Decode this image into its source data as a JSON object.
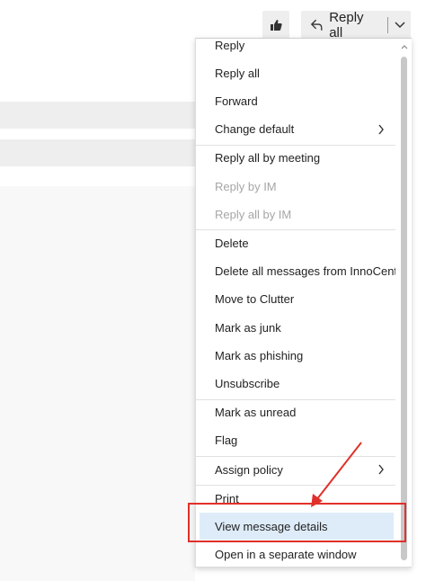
{
  "toolbar": {
    "like_icon": "thumbs-up-icon",
    "reply_all_label": "Reply all",
    "reply_all_icon": "reply-all-icon",
    "more_icon": "chevron-down-icon"
  },
  "menu": {
    "groups": [
      [
        {
          "label": "Reply",
          "enabled": true
        },
        {
          "label": "Reply all",
          "enabled": true
        },
        {
          "label": "Forward",
          "enabled": true
        },
        {
          "label": "Change default",
          "enabled": true,
          "submenu": true
        }
      ],
      [
        {
          "label": "Reply all by meeting",
          "enabled": true
        },
        {
          "label": "Reply by IM",
          "enabled": false
        },
        {
          "label": "Reply all by IM",
          "enabled": false
        }
      ],
      [
        {
          "label": "Delete",
          "enabled": true
        },
        {
          "label": "Delete all messages from InnoCentiv",
          "enabled": true
        },
        {
          "label": "Move to Clutter",
          "enabled": true
        },
        {
          "label": "Mark as junk",
          "enabled": true
        },
        {
          "label": "Mark as phishing",
          "enabled": true
        },
        {
          "label": "Unsubscribe",
          "enabled": true
        }
      ],
      [
        {
          "label": "Mark as unread",
          "enabled": true
        },
        {
          "label": "Flag",
          "enabled": true
        }
      ],
      [
        {
          "label": "Assign policy",
          "enabled": true,
          "submenu": true
        }
      ],
      [
        {
          "label": "Print",
          "enabled": true
        },
        {
          "label": "View message details",
          "enabled": true,
          "highlighted": true
        },
        {
          "label": "Open in a separate window",
          "enabled": true
        }
      ]
    ]
  },
  "annotation": {
    "color": "#e0302a",
    "target": "View message details"
  },
  "colors": {
    "highlight": "#deecf9",
    "disabled_text": "#a6a6a6",
    "toolbar_button": "#eeeeee"
  }
}
